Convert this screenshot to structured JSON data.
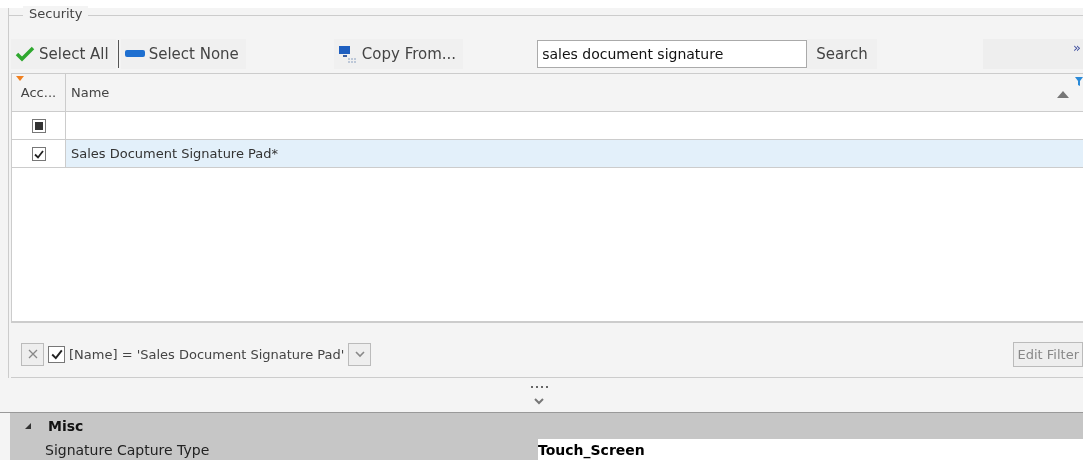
{
  "group": {
    "title": "Security"
  },
  "toolbar": {
    "select_all": "Select All",
    "select_none": "Select None",
    "copy_from": "Copy From...",
    "search": {
      "value": "sales document signature"
    },
    "search_button": "Search",
    "overflow": "»"
  },
  "grid": {
    "columns": [
      "Acc...",
      "Name"
    ],
    "rows": [
      {
        "indeterminate": true,
        "checked": false,
        "name": "",
        "selected": false
      },
      {
        "indeterminate": false,
        "checked": true,
        "name": "Sales Document Signature Pad*",
        "selected": true
      }
    ]
  },
  "filter": {
    "enabled": true,
    "text": "[Name] = 'Sales Document Signature Pad'",
    "edit_button": "Edit Filter"
  },
  "properties": {
    "category": "Misc",
    "expanded": true,
    "rows": [
      {
        "name": "Signature Capture Type",
        "value": "Touch_Screen"
      }
    ]
  }
}
